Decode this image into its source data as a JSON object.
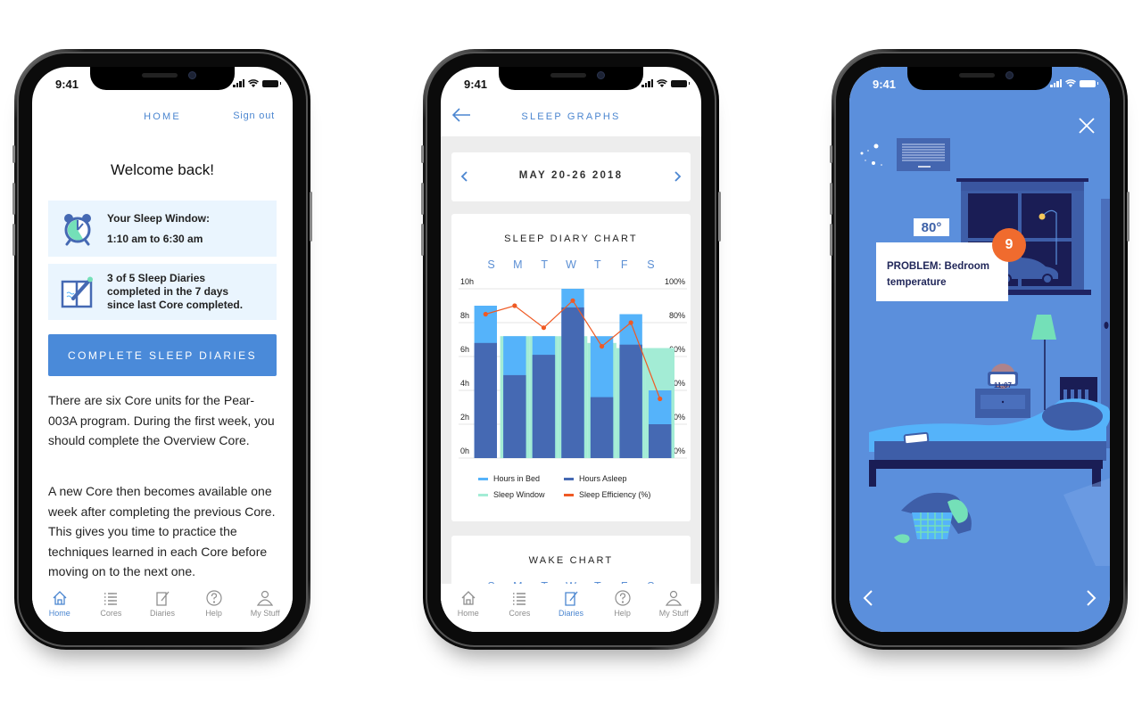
{
  "status_bar": {
    "time": "9:41"
  },
  "home_screen": {
    "nav_title": "HOME",
    "sign_out": "Sign out",
    "welcome": "Welcome back!",
    "sleep_window": {
      "icon": "alarm-clock-icon",
      "label": "Your Sleep Window:",
      "value": "1:10 am to 6:30 am"
    },
    "diaries_status": {
      "icon": "diary-pen-icon",
      "line1": "3 of 5 Sleep Diaries",
      "line2": "completed in the 7 days",
      "line3": "since last Core completed."
    },
    "cta_button": "COMPLETE SLEEP DIARIES",
    "paragraphs": [
      "There are six Core units for the Pear-003A program. During the first week, you should complete the Overview Core.",
      "A new Core then becomes available one week after completing the previous Core. This gives you time to practice the techniques learned in each Core before moving on to the next one."
    ],
    "active_tab": "Home"
  },
  "tabs": [
    {
      "label": "Home",
      "icon": "home-icon"
    },
    {
      "label": "Cores",
      "icon": "list-icon"
    },
    {
      "label": "Diaries",
      "icon": "diary-icon"
    },
    {
      "label": "Help",
      "icon": "help-icon"
    },
    {
      "label": "My Stuff",
      "icon": "person-icon"
    }
  ],
  "graphs_screen": {
    "nav_title": "SLEEP GRAPHS",
    "week_label": "MAY 20-26 2018",
    "wake_chart_title": "WAKE CHART",
    "active_tab": "Diaries"
  },
  "chart_data": {
    "type": "bar",
    "title": "SLEEP DIARY CHART",
    "categories": [
      "S",
      "M",
      "T",
      "W",
      "T",
      "F",
      "S"
    ],
    "series": [
      {
        "name": "Sleep Window",
        "axis": "left",
        "color": "#a3ecd5",
        "values": [
          0,
          7.2,
          7.2,
          7.2,
          6.8,
          6.5,
          6.5
        ]
      },
      {
        "name": "Hours in Bed",
        "axis": "left",
        "color": "#55b3fa",
        "values": [
          9.0,
          7.2,
          7.2,
          10.0,
          7.2,
          8.5,
          4.0
        ]
      },
      {
        "name": "Hours Asleep",
        "axis": "left",
        "color": "#4569b3",
        "values": [
          6.8,
          4.9,
          6.1,
          8.9,
          3.6,
          6.7,
          2.0
        ]
      },
      {
        "name": "Sleep Efficiency (%)",
        "axis": "right",
        "type": "line",
        "color": "#ef5a24",
        "values": [
          85,
          90,
          77,
          93,
          66,
          80,
          35
        ]
      }
    ],
    "y_left": {
      "ticks": [
        "0h",
        "2h",
        "4h",
        "6h",
        "8h",
        "10h"
      ],
      "range": [
        0,
        10
      ]
    },
    "y_right": {
      "ticks": [
        "0%",
        "20%",
        "40%",
        "60%",
        "80%",
        "100%"
      ],
      "range": [
        0,
        100
      ]
    },
    "grid": true,
    "legend": [
      {
        "label": "Hours in Bed",
        "color": "#55b3fa"
      },
      {
        "label": "Hours Asleep",
        "color": "#4569b3"
      },
      {
        "label": "Sleep Window",
        "color": "#a3ecd5"
      },
      {
        "label": "Sleep Efficiency (%)",
        "color": "#ef5a24"
      }
    ],
    "legend_position": "bottom"
  },
  "scene_screen": {
    "badge_number": "9",
    "callout": "PROBLEM: Bedroom temperature",
    "thermostat": "80°",
    "clock_time": "11:07"
  },
  "colors": {
    "accent": "#4a8ad9",
    "card_bg": "#eaf5fe",
    "scene_bg": "#5b8fdc",
    "badge": "#f06b2e"
  }
}
